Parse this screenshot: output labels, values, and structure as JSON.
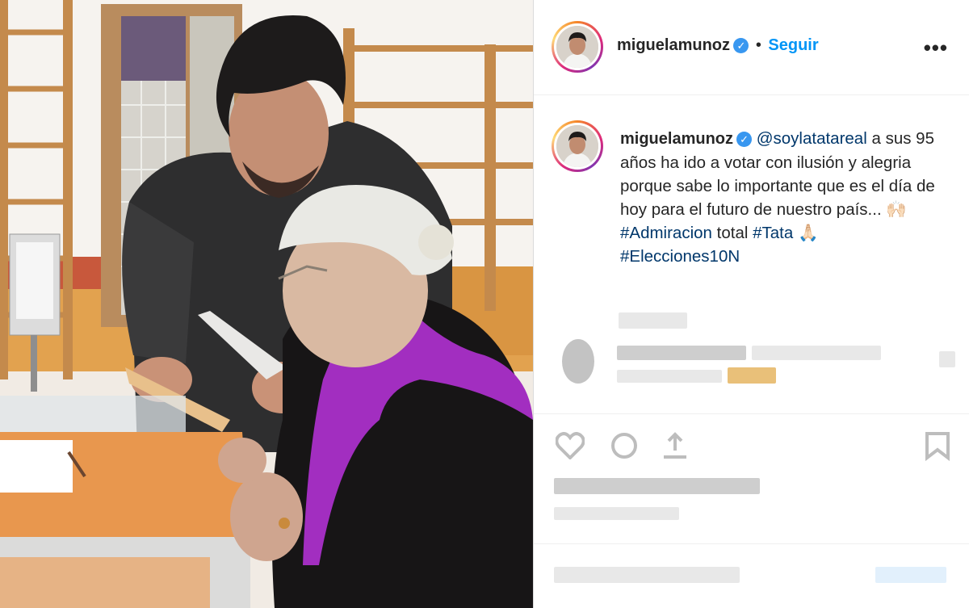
{
  "post": {
    "username": "miguelamunoz",
    "follow_label": "Seguir",
    "separator": "•",
    "more_label": "•••",
    "verified_mark": "✓"
  },
  "caption": {
    "username": "miguelamunoz",
    "mention": "@soylatatareal",
    "text": "a sus 95 años ha ido a votar con ilusión y alegria porque sabe lo importante que es el día de hoy para el futuro de nuestro país...",
    "emoji_hands": "🙌🏻",
    "hashtag1": "#Admiracion",
    "word_total": "total",
    "hashtag2": "#Tata",
    "emoji_pray": "🙏🏻",
    "hashtag3": "#Elecciones10N"
  },
  "icons": {
    "like": "heart-icon",
    "comment": "comment-icon",
    "share": "share-icon",
    "save": "bookmark-icon"
  },
  "colors": {
    "follow_blue": "#0095f6",
    "hashtag_blue": "#00376b",
    "verified_blue": "#3897f0",
    "scarf_purple": "#a22ec0"
  }
}
